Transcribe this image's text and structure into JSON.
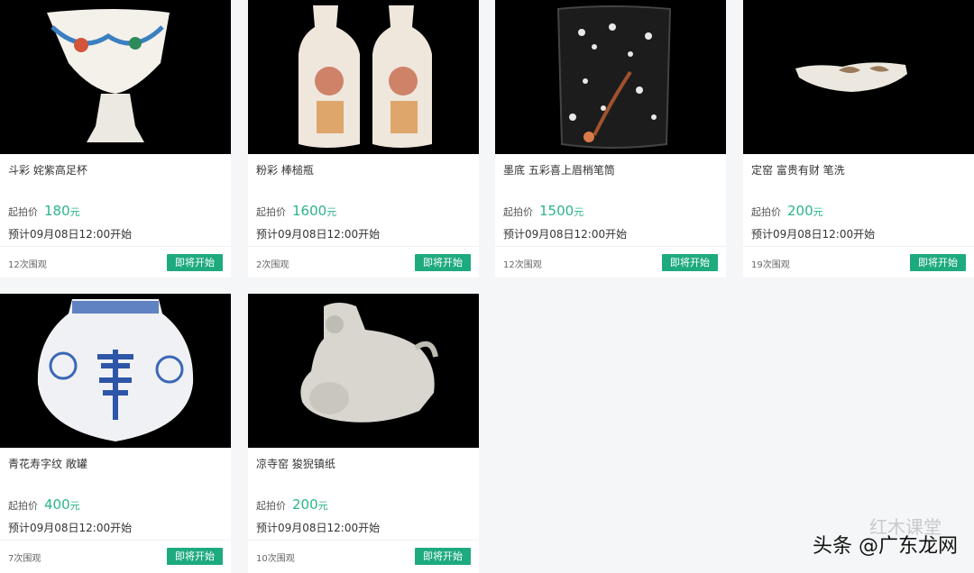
{
  "lots": [
    {
      "title": "斗彩 姹紫高足杯",
      "price_label": "起拍价",
      "price": "180",
      "unit": "元",
      "schedule": "预计09月08日12:00开始",
      "views": "12次围观",
      "status": "即将开始"
    },
    {
      "title": "粉彩 棒槌瓶",
      "price_label": "起拍价",
      "price": "1600",
      "unit": "元",
      "schedule": "预计09月08日12:00开始",
      "views": "2次围观",
      "status": "即将开始"
    },
    {
      "title": "墨底 五彩喜上眉梢笔筒",
      "price_label": "起拍价",
      "price": "1500",
      "unit": "元",
      "schedule": "预计09月08日12:00开始",
      "views": "12次围观",
      "status": "即将开始"
    },
    {
      "title": "定窑 富贵有财 笔洗",
      "price_label": "起拍价",
      "price": "200",
      "unit": "元",
      "schedule": "预计09月08日12:00开始",
      "views": "19次围观",
      "status": "即将开始"
    },
    {
      "title": "青花寿字纹 敞罐",
      "price_label": "起拍价",
      "price": "400",
      "unit": "元",
      "schedule": "预计09月08日12:00开始",
      "views": "7次围观",
      "status": "即将开始"
    },
    {
      "title": "凉寺窑 狻猊镇纸",
      "price_label": "起拍价",
      "price": "200",
      "unit": "元",
      "schedule": "预计09月08日12:00开始",
      "views": "10次围观",
      "status": "即将开始"
    }
  ],
  "watermark": {
    "top": "红木课堂",
    "bottom": "头条 @广东龙网"
  },
  "colors": {
    "accent": "#1eaa7f",
    "price": "#2bb48a",
    "thumb_bg": "#000000"
  }
}
